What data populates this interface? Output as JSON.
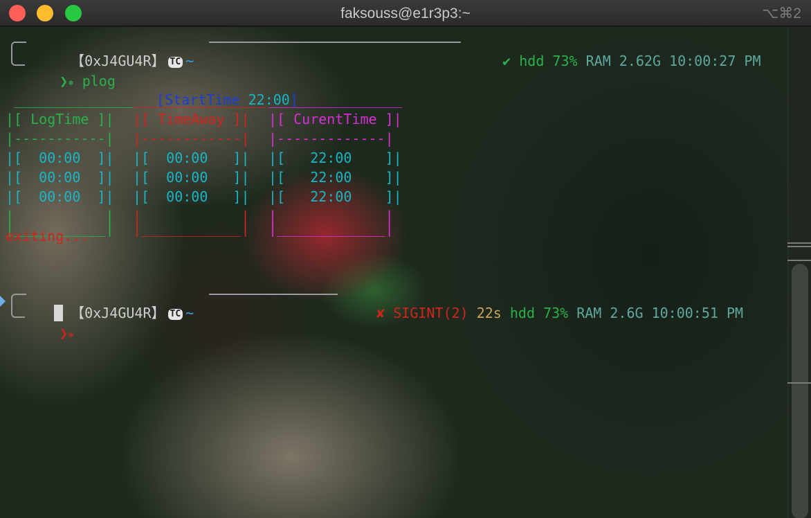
{
  "window": {
    "title": "faksouss@e1r3p3:~",
    "shortcut": "⌥⌘2"
  },
  "prompt1": {
    "user": "【0xJ4GU4R】",
    "badge": "TC",
    "dir": "~",
    "status_icon": "✔",
    "hdd": "hdd 73%",
    "ram": "RAM 2.62G",
    "time": "10:00:27 PM",
    "arrow": "❯",
    "star": "⎈",
    "command": "plog"
  },
  "output": {
    "start_label": "[StartTime ",
    "start_time": "22:00",
    "start_close": "]",
    "table": {
      "log": {
        "top": " _______________",
        "header": "|[ LogTime ]|",
        "sep": "|-----------|",
        "rows": [
          "|[  00:00  ]|",
          "|[  00:00  ]|",
          "|[  00:00  ]|"
        ],
        "empty": "|           |",
        "bottom": "|___________|"
      },
      "away": {
        "top": "________________",
        "header": "|[ TimeAway ]|",
        "sep": "|------------|",
        "rows": [
          "|[  00:00   ]|",
          "|[  00:00   ]|",
          "|[  00:00   ]|"
        ],
        "empty": "|            |",
        "bottom": "|____________|"
      },
      "current": {
        "top": "________________",
        "header": "|[ CurentTime ]|",
        "sep": "|-------------|",
        "rows": [
          "|[   22:00    ]|",
          "|[   22:00    ]|",
          "|[   22:00    ]|"
        ],
        "empty": "|             |",
        "bottom": "|_____________|"
      }
    },
    "exiting": "exiting..."
  },
  "prompt2": {
    "user": "【0xJ4GU4R】",
    "badge": "TC",
    "dir": "~",
    "status_icon": "✘",
    "signal": "SIGINT(2)",
    "duration": "22s",
    "hdd": "hdd 73%",
    "ram": "RAM 2.6G",
    "time": "10:00:51 PM",
    "arrow": "❯",
    "star": "⎈"
  },
  "colors": {
    "green": "#2bb04a",
    "red": "#d0241c",
    "magenta": "#d92fd2",
    "cyan": "#19b6c6",
    "blue": "#1a3fd1"
  }
}
